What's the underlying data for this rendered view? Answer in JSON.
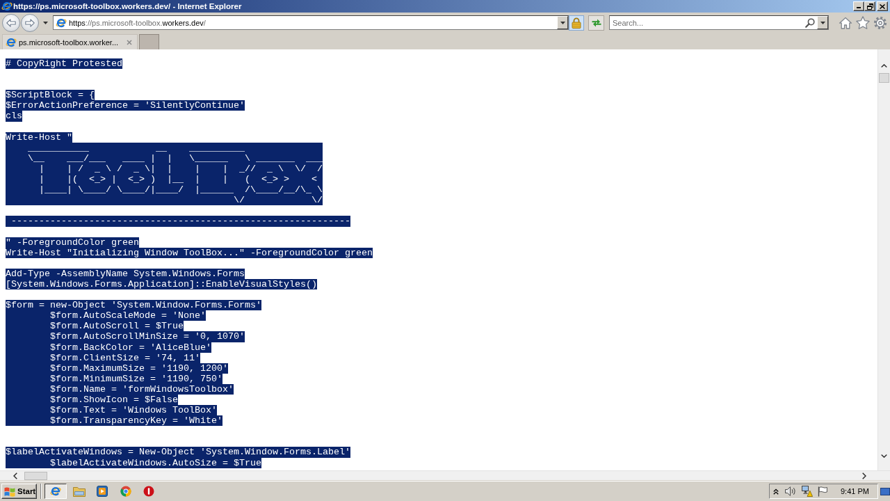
{
  "window": {
    "title": "https://ps.microsoft-toolbox.workers.dev/ - Internet Explorer"
  },
  "address_bar": {
    "url": "**https**://ps.microsoft-toolbox.**workers.dev**/"
  },
  "search": {
    "placeholder": "Search..."
  },
  "tabs": [
    {
      "label": "ps.microsoft-toolbox.worker...",
      "selected": true
    }
  ],
  "document": {
    "lines": [
      {
        "kind": "code",
        "text": "# CopyRight Protested",
        "selected": true
      },
      {
        "kind": "blank"
      },
      {
        "kind": "blank"
      },
      {
        "kind": "code",
        "text": "$ScriptBlock = {",
        "selected": true
      },
      {
        "kind": "code",
        "text": "$ErrorActionPreference = 'SilentlyContinue'",
        "selected": true
      },
      {
        "kind": "code",
        "text": "cls",
        "selected": true
      },
      {
        "kind": "blank"
      },
      {
        "kind": "code",
        "text": "Write-Host \"",
        "selected": true
      },
      {
        "kind": "art",
        "text": "    ___________            __    __________\n    \\__    ___/___   ____ |  |   \\______   \\ _______  ___\n      |    | /  _ \\ /  _ \\|  |    |    |  _//  _ \\  \\/  /\n      |    |(  <_> |  <_> )  |__  |    |   (  <_> >    <\n      |____| \\____/ \\____/|____/  |______  /\\____/__/\\_ \\\n                                         \\/            \\/",
        "selected": true
      },
      {
        "kind": "blank"
      },
      {
        "kind": "code",
        "text": " -------------------------------------------------------------",
        "selected": true
      },
      {
        "kind": "blank"
      },
      {
        "kind": "code",
        "text": "\" -ForegroundColor green",
        "selected": true
      },
      {
        "kind": "code",
        "text": "Write-Host \"Initializing Window ToolBox...\" -ForegroundColor green",
        "selected": true
      },
      {
        "kind": "blank"
      },
      {
        "kind": "code",
        "text": "Add-Type -AssemblyName System.Windows.Forms",
        "selected": true
      },
      {
        "kind": "code",
        "text": "[System.Windows.Forms.Application]::EnableVisualStyles()",
        "selected": true
      },
      {
        "kind": "blank"
      },
      {
        "kind": "code",
        "text": "$form = new-Object 'System.Window.Forms.Forms'",
        "selected": true
      },
      {
        "kind": "code",
        "text": "\t$form.AutoScaleMode = 'None'",
        "selected": true
      },
      {
        "kind": "code",
        "text": "\t$form.AutoScroll = $True",
        "selected": true
      },
      {
        "kind": "code",
        "text": "\t$form.AutoScrollMinSize = '0, 1070'",
        "selected": true
      },
      {
        "kind": "code",
        "text": "\t$form.BackColor = 'AliceBlue'",
        "selected": true
      },
      {
        "kind": "code",
        "text": "\t$form.ClientSize = '74, 11'",
        "selected": true
      },
      {
        "kind": "code",
        "text": "\t$form.MaximumSize = '1190, 1200'",
        "selected": true
      },
      {
        "kind": "code",
        "text": "\t$form.MinimumSize = '1190, 750'",
        "selected": true
      },
      {
        "kind": "code",
        "text": "\t$form.Name = 'formWindowsToolbox'",
        "selected": true
      },
      {
        "kind": "code",
        "text": "\t$form.ShowIcon = $False",
        "selected": true
      },
      {
        "kind": "code",
        "text": "\t$form.Text = 'Windows ToolBox'",
        "selected": true
      },
      {
        "kind": "code",
        "text": "\t$form.TransparencyKey = 'White'",
        "selected": true
      },
      {
        "kind": "blank"
      },
      {
        "kind": "blank"
      },
      {
        "kind": "code",
        "text": "$labelActivateWindows = New-Object 'System.Window.Forms.Label'",
        "selected": true
      },
      {
        "kind": "code",
        "text": "\t$labelActivateWindows.AutoSize = $True",
        "selected": true
      }
    ]
  },
  "taskbar": {
    "start": "Start",
    "apps": [
      {
        "selected": true
      },
      {
        "selected": false
      },
      {
        "selected": false
      },
      {
        "selected": false
      },
      {
        "selected": false
      }
    ],
    "clock": "9:41 PM"
  }
}
